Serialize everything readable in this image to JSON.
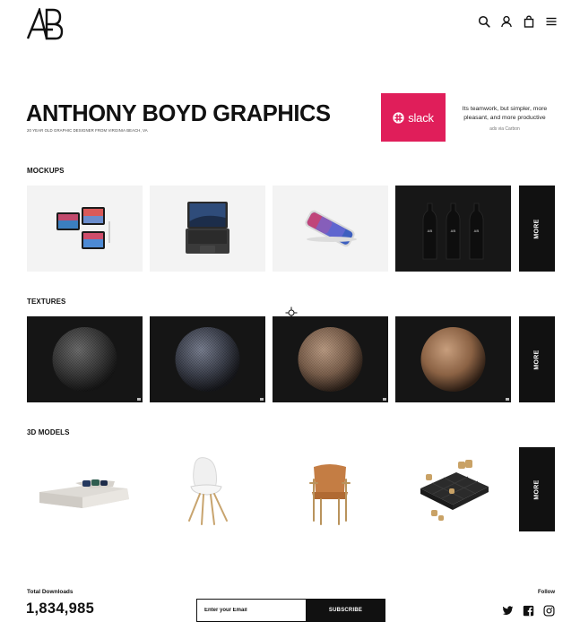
{
  "brand": {
    "logo_text": "AB",
    "logo_icon": "ab-monogram-logo"
  },
  "nav": {
    "icons": [
      "search-icon",
      "user-icon",
      "shopping-bag-icon",
      "hamburger-menu-icon"
    ]
  },
  "hero": {
    "title": "ANTHONY BOYD GRAPHICS",
    "subtitle": "20 YEAR OLD GRAPHIC DESIGNER FROM VIRGINIA BEACH, VA"
  },
  "ad": {
    "brand_word": "slack",
    "text": "Its teamwork, but simpler, more pleasant, and more productive",
    "via": "ads via Carbon",
    "bg_color": "#e01e5a"
  },
  "sections": {
    "mockups": {
      "title": "MOCKUPS",
      "items": [
        "ipad-mockup",
        "macbook-mockup",
        "iphone-x-mockup",
        "bottle-mockup"
      ],
      "more_label": "MORE"
    },
    "textures": {
      "title": "TEXTURES",
      "items": [
        "dark-mesh-sphere",
        "dark-fabric-sphere",
        "wood-sphere",
        "leather-sphere"
      ],
      "more_label": "MORE"
    },
    "models": {
      "title": "3D MODELS",
      "items": [
        "sofa-model",
        "white-chair-model",
        "leather-chair-model",
        "board-game-model"
      ],
      "more_label": "MORE"
    }
  },
  "footer": {
    "downloads_label": "Total Downloads",
    "downloads_count": "1,834,985",
    "email_placeholder": "Enter your Email",
    "subscribe_label": "SUBSCRIBE",
    "follow_label": "Follow",
    "social_icons": [
      "twitter-icon",
      "facebook-icon",
      "instagram-icon"
    ]
  },
  "colors": {
    "text": "#111111",
    "accent_dark": "#111111",
    "tile_light": "#f3f3f3",
    "tile_dark": "#1a1a1a"
  }
}
